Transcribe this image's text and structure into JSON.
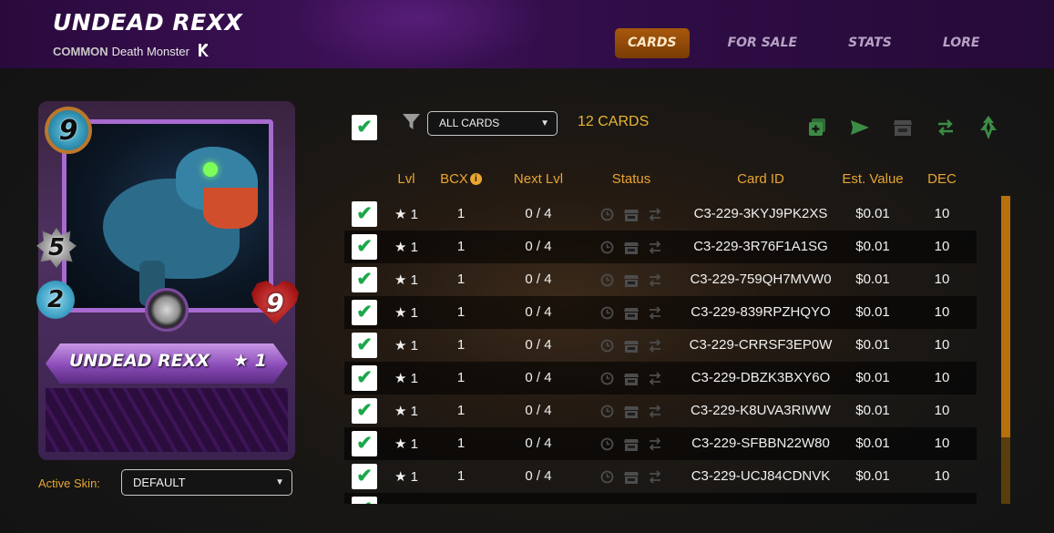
{
  "header": {
    "title": "UNDEAD REXX",
    "rarity": "COMMON",
    "type_text": "Death Monster",
    "edition_icon": "rebellion-edition-icon",
    "tabs": [
      {
        "label": "CARDS",
        "active": true
      },
      {
        "label": "FOR SALE",
        "active": false
      },
      {
        "label": "STATS",
        "active": false
      },
      {
        "label": "LORE",
        "active": false
      }
    ]
  },
  "card": {
    "name": "UNDEAD REXX",
    "level": "★ 1",
    "mana": "9",
    "attack": "5",
    "speed": "2",
    "health": "9"
  },
  "skin": {
    "label": "Active Skin:",
    "selected": "DEFAULT"
  },
  "toolbar": {
    "filter_selected": "ALL CARDS",
    "count": "12 CARDS",
    "icons": [
      "combine-icon",
      "send-icon",
      "market-icon",
      "transfer-icon",
      "burn-icon"
    ]
  },
  "table": {
    "headers": {
      "lvl": "Lvl",
      "bcx": "BCX",
      "next_lvl": "Next Lvl",
      "status": "Status",
      "card_id": "Card ID",
      "est_value": "Est. Value",
      "dec": "DEC"
    },
    "rows": [
      {
        "lvl": "★ 1",
        "bcx": "1",
        "next": "0 / 4",
        "id": "C3-229-3KYJ9PK2XS",
        "value": "$0.01",
        "dec": "10"
      },
      {
        "lvl": "★ 1",
        "bcx": "1",
        "next": "0 / 4",
        "id": "C3-229-3R76F1A1SG",
        "value": "$0.01",
        "dec": "10"
      },
      {
        "lvl": "★ 1",
        "bcx": "1",
        "next": "0 / 4",
        "id": "C3-229-759QH7MVW0",
        "value": "$0.01",
        "dec": "10"
      },
      {
        "lvl": "★ 1",
        "bcx": "1",
        "next": "0 / 4",
        "id": "C3-229-839RPZHQYO",
        "value": "$0.01",
        "dec": "10"
      },
      {
        "lvl": "★ 1",
        "bcx": "1",
        "next": "0 / 4",
        "id": "C3-229-CRRSF3EP0W",
        "value": "$0.01",
        "dec": "10"
      },
      {
        "lvl": "★ 1",
        "bcx": "1",
        "next": "0 / 4",
        "id": "C3-229-DBZK3BXY6O",
        "value": "$0.01",
        "dec": "10"
      },
      {
        "lvl": "★ 1",
        "bcx": "1",
        "next": "0 / 4",
        "id": "C3-229-K8UVA3RIWW",
        "value": "$0.01",
        "dec": "10"
      },
      {
        "lvl": "★ 1",
        "bcx": "1",
        "next": "0 / 4",
        "id": "C3-229-SFBBN22W80",
        "value": "$0.01",
        "dec": "10"
      },
      {
        "lvl": "★ 1",
        "bcx": "1",
        "next": "0 / 4",
        "id": "C3-229-UCJ84CDNVK",
        "value": "$0.01",
        "dec": "10"
      }
    ]
  },
  "colors": {
    "accent_orange": "#e8a530",
    "count_yellow": "#e8b62f",
    "check_green": "#1aa84a",
    "header_purple": "#3d1157"
  }
}
